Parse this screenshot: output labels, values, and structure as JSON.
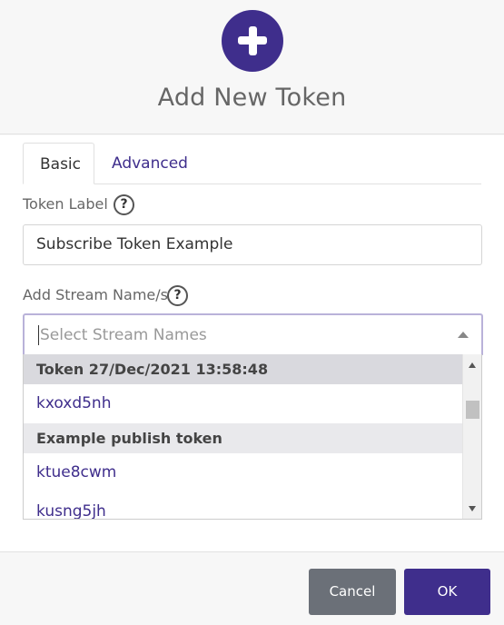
{
  "dialog": {
    "title": "Add New Token"
  },
  "tabs": [
    {
      "label": "Basic"
    },
    {
      "label": "Advanced"
    }
  ],
  "token_label": {
    "label": "Token Label",
    "help": "?",
    "value": "Subscribe Token Example"
  },
  "stream_names": {
    "label": "Add Stream Name/s",
    "help": "?",
    "placeholder": "Select Stream Names",
    "groups": [
      {
        "label": "Token 27/Dec/2021 13:58:48",
        "options": [
          "kxoxd5nh"
        ]
      },
      {
        "label": "Example publish token",
        "options": [
          "ktue8cwm",
          "kusng5jh"
        ]
      }
    ]
  },
  "buttons": {
    "cancel": "Cancel",
    "ok": "OK"
  },
  "colors": {
    "accent": "#3f2e8c",
    "cancel": "#6b7078"
  }
}
